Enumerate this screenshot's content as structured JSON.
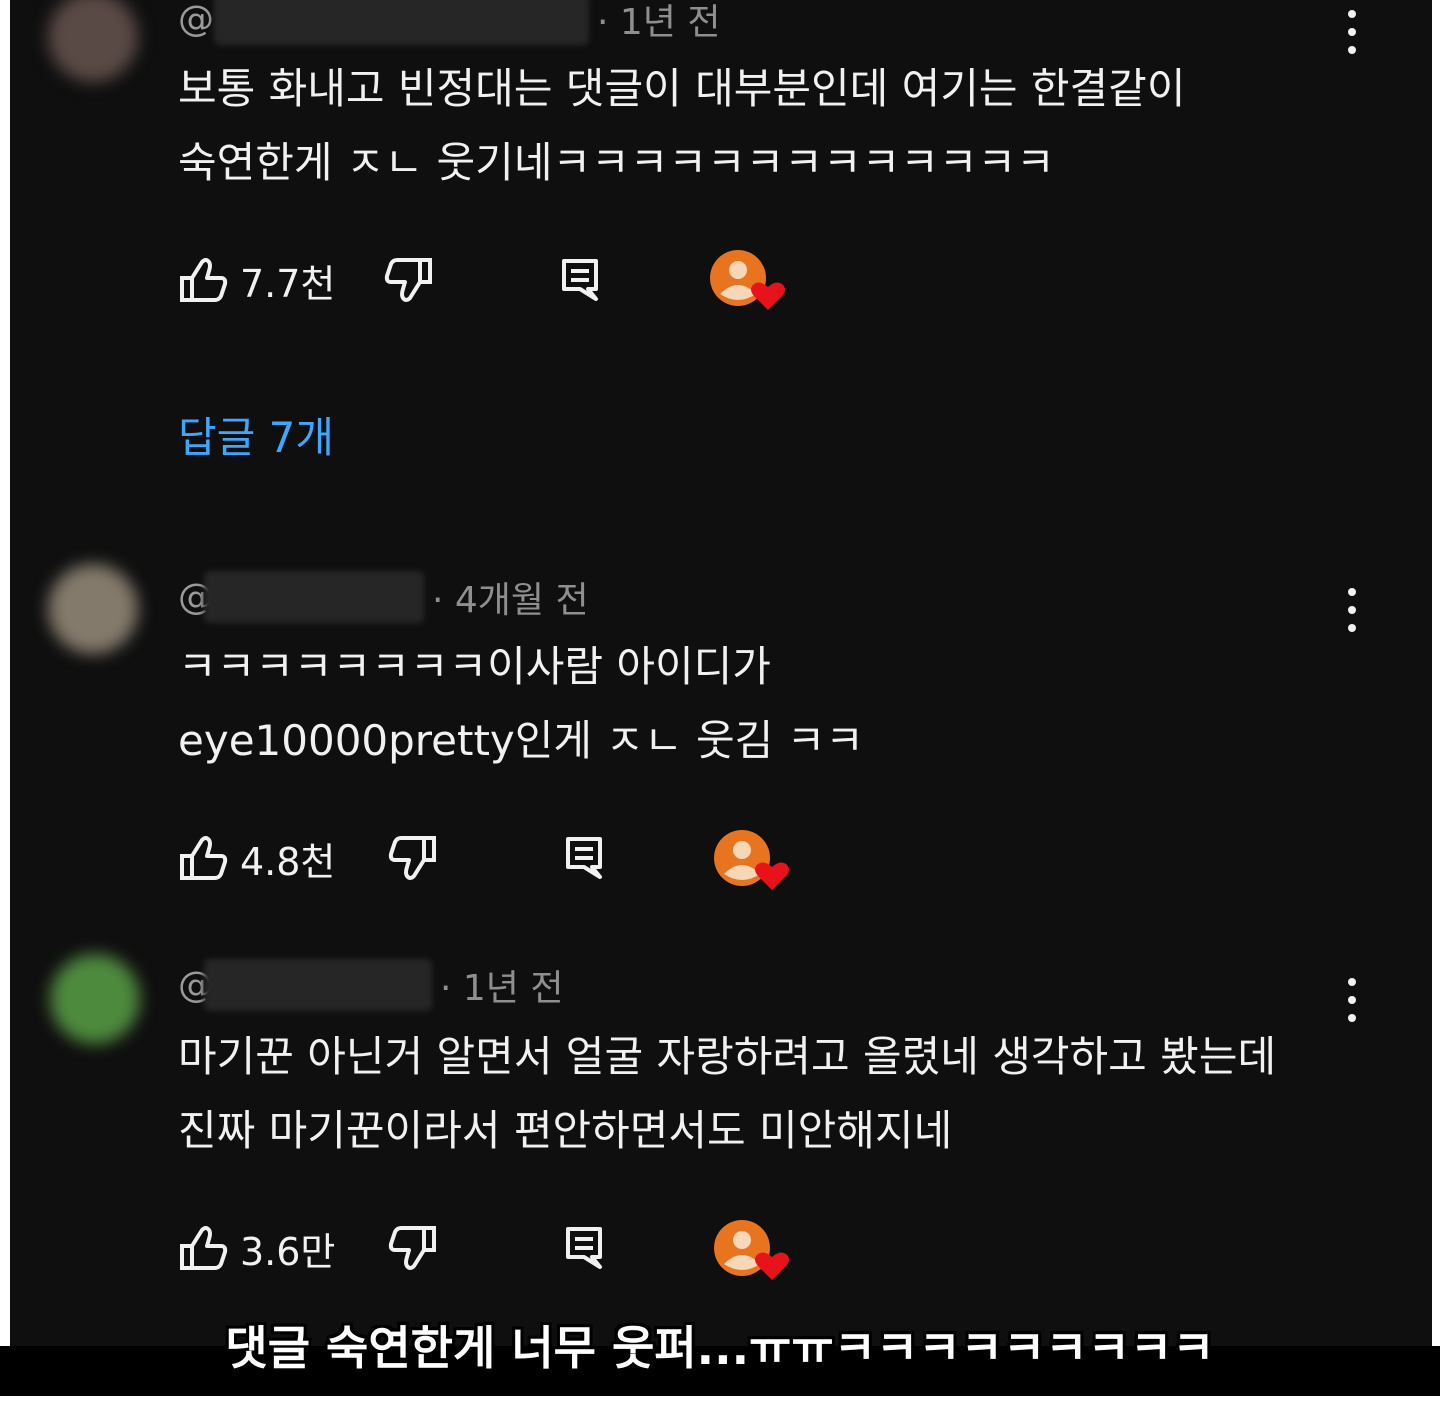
{
  "comments": [
    {
      "handle_prefix": "@",
      "time": "· 1년 전",
      "lines": [
        "보통 화내고 빈정대는 댓글이 대부분인데 여기는 한결같이",
        "숙연한게 ㅈㄴ 웃기네ㅋㅋㅋㅋㅋㅋㅋㅋㅋㅋㅋㅋㅋ"
      ],
      "likes": "7.7천",
      "replies_label": "답글 7개",
      "avatar_color": "#5a4a46"
    },
    {
      "handle_prefix": "@",
      "time": "· 4개월 전",
      "lines": [
        "ㅋㅋㅋㅋㅋㅋㅋㅋ이사람 아이디가",
        "eye10000pretty인게 ㅈㄴ 웃김 ㅋㅋ"
      ],
      "likes": "4.8천",
      "avatar_color": "#847a6c"
    },
    {
      "handle_prefix": "@",
      "time": "· 1년 전",
      "lines": [
        "마기꾼 아닌거 알면서 얼굴 자랑하려고 올렸네 생각하고 봤는데",
        "진짜 마기꾼이라서 편안하면서도 미안해지네"
      ],
      "likes": "3.6만",
      "avatar_color": "#4e8a3e"
    }
  ],
  "colors": {
    "background": "#0f0f0f",
    "text": "#f1f1f1",
    "meta": "#8f8f8f",
    "link": "#3ea6ff",
    "heart": "#e8121a",
    "creator_avatar": "#e8741f"
  },
  "icons": {
    "like": "thumbs-up-icon",
    "dislike": "thumbs-down-icon",
    "reply": "reply-icon",
    "more": "more-vert-icon",
    "heart": "creator-heart-icon"
  },
  "caption": "댓글 숙연한게 너무 웃퍼...ㅠㅠㅋㅋㅋㅋㅋㅋㅋㅋㅋ"
}
